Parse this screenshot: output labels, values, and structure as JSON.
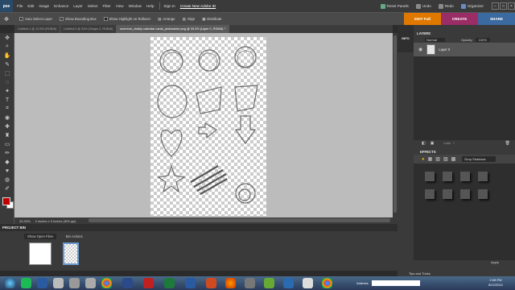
{
  "app": {
    "logo": "pse"
  },
  "menu": {
    "items": [
      "File",
      "Edit",
      "Image",
      "Enhance",
      "Layer",
      "Select",
      "Filter",
      "View",
      "Window",
      "Help"
    ]
  },
  "account": {
    "sign_in": "Sign In",
    "create_id": "Create New Adobe ID"
  },
  "top_right": {
    "reset_panels": "Reset Panels",
    "undo": "Undo",
    "redo": "Redo",
    "organizer": "Organizer"
  },
  "options": {
    "auto_select": "Auto Select Layer",
    "show_bounding": "Show Bounding Box",
    "show_highlight": "Show Highlight on Rollover",
    "arrange": "Arrange",
    "align": "Align",
    "distribute": "Distribute"
  },
  "modes": [
    {
      "label": "EDIT Full",
      "color": "#e07800"
    },
    {
      "label": "CREATE",
      "color": "#9a2c66"
    },
    {
      "label": "SHARE",
      "color": "#3a6aa0"
    }
  ],
  "tabs": [
    {
      "label": "Untitled-1 @ 12.5% (RGB/8)",
      "active": false
    },
    {
      "label": "Untitled-2 @ 33% (Shape 2, RGB/8)",
      "active": false
    },
    {
      "label": "onemore_chalky calendar cards_pinkmarker.png @ 33.3% (Layer 0, RGB/8) *",
      "active": true
    }
  ],
  "status": {
    "zoom": "33.33%",
    "size": "2 inches x 3 inches (300 ppi)"
  },
  "project_bin": {
    "title": "PROJECT BIN",
    "show_open": "Show Open Files",
    "bin_actions": "Bin Actions"
  },
  "panels": {
    "info_label": "INFO",
    "layers_title": "LAYERS",
    "blend_mode": "Normal",
    "opacity_label": "Opacity:",
    "opacity_value": "100%",
    "layer_name": "Layer 0",
    "lock_label": "Lock:",
    "effects_title": "EFFECTS",
    "effect_category": "Drop Shadows",
    "apply": "Apply",
    "tips": "Tips and Tricks"
  },
  "taskbar": {
    "address_label": "Address",
    "time": "2:08 PM",
    "date": "8/12/2012",
    "icons": [
      "start-orb",
      "spotify",
      "outlook",
      "itunes",
      "calculator",
      "chrome",
      "photoshop-elements",
      "organizer",
      "filezilla",
      "excel",
      "word",
      "powerpoint",
      "firefox",
      "misc-app",
      "green-app",
      "outlook-2",
      "paint",
      "chrome-2"
    ]
  }
}
